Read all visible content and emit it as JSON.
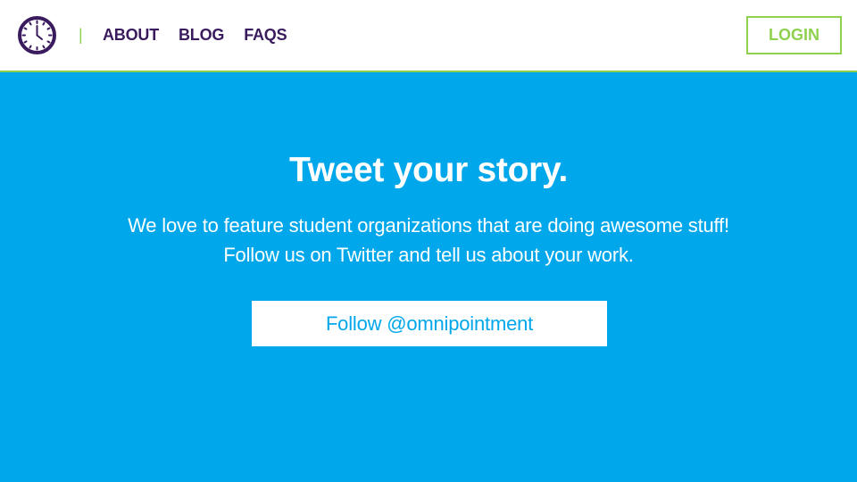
{
  "header": {
    "logo_icon": "clock-icon",
    "divider": "|",
    "nav": [
      {
        "label": "ABOUT"
      },
      {
        "label": "BLOG"
      },
      {
        "label": "FAQS"
      }
    ],
    "login_label": "LOGIN"
  },
  "hero": {
    "title": "Tweet your story.",
    "line1": "We love to feature student organizations that are doing awesome stuff!",
    "line2": "Follow us on Twitter and tell us about your work.",
    "follow_label": "Follow @omnipointment"
  },
  "colors": {
    "brand_purple": "#3a1b5e",
    "accent_green": "#8fd14f",
    "hero_blue": "#00a7ea",
    "white": "#ffffff"
  }
}
